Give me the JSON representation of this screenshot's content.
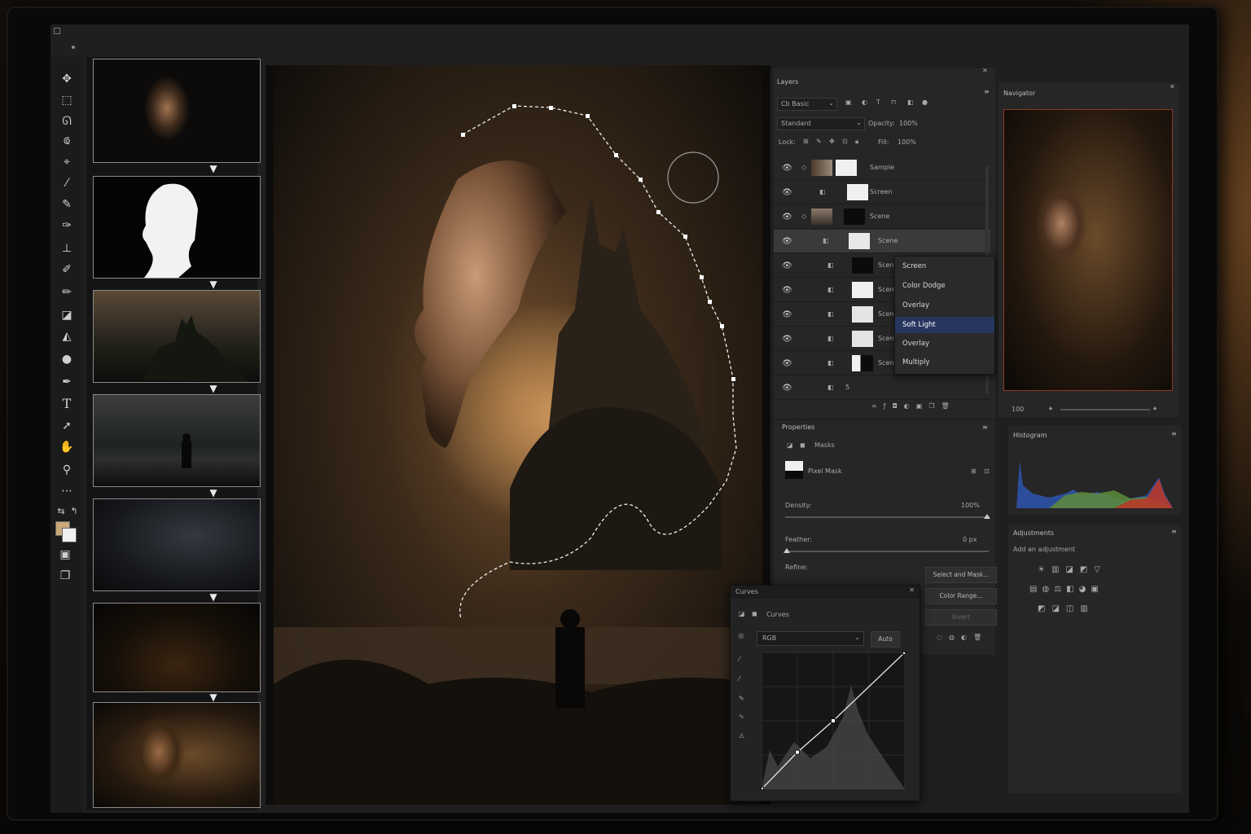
{
  "colors": {
    "accent": "#26365e",
    "panel": "#262626",
    "canvas_bg": "#0d0c0b",
    "navigator_border": "#8a3a25"
  },
  "layers": {
    "title": "Layers",
    "filter": "Cb Basic",
    "blend_mode": "Standard",
    "opacity_label": "Opacity:",
    "opacity_value": "100%",
    "lock_label": "Lock:",
    "fill_label": "Fill:",
    "fill_value": "100%",
    "rows": [
      {
        "name": "Sample",
        "visible": true
      },
      {
        "name": "Screen",
        "visible": true
      },
      {
        "name": "Scene",
        "visible": true
      },
      {
        "name": "Scene",
        "visible": true,
        "selected": true
      },
      {
        "name": "Scene",
        "visible": true
      },
      {
        "name": "Scene",
        "visible": true
      },
      {
        "name": "Scene",
        "visible": true
      },
      {
        "name": "Scene",
        "visible": true
      },
      {
        "name": "Scene",
        "visible": true
      },
      {
        "name": "5",
        "visible": true
      }
    ]
  },
  "blend_menu": {
    "items": [
      "Screen",
      "Color Dodge",
      "Overlay",
      "Soft Light",
      "Overlay",
      "Multiply"
    ],
    "selected_index": 3
  },
  "navigator": {
    "title": "Navigator",
    "zoom": "100"
  },
  "histogram": {
    "title": "Histogram"
  },
  "properties": {
    "title": "Properties",
    "section": "Masks",
    "mask_label": "Pixel Mask",
    "density_label": "Density:",
    "density_value": "100%",
    "feather_label": "Feather:",
    "feather_value": "0 px",
    "refine_label": "Refine:",
    "select_mask_button": "Select and Mask...",
    "color_range_button": "Color Range...",
    "invert_button": "Invert"
  },
  "adjustments": {
    "title": "Adjustments",
    "subtitle": "Add an adjustment"
  },
  "curves": {
    "window_title": "Curves",
    "tab_label": "Curves",
    "channel": "RGB",
    "auto_button": "Auto",
    "points": [
      [
        0,
        0
      ],
      [
        0.25,
        0.27
      ],
      [
        0.5,
        0.5
      ],
      [
        1,
        1
      ]
    ]
  },
  "workflow": {
    "step_count": 7
  }
}
